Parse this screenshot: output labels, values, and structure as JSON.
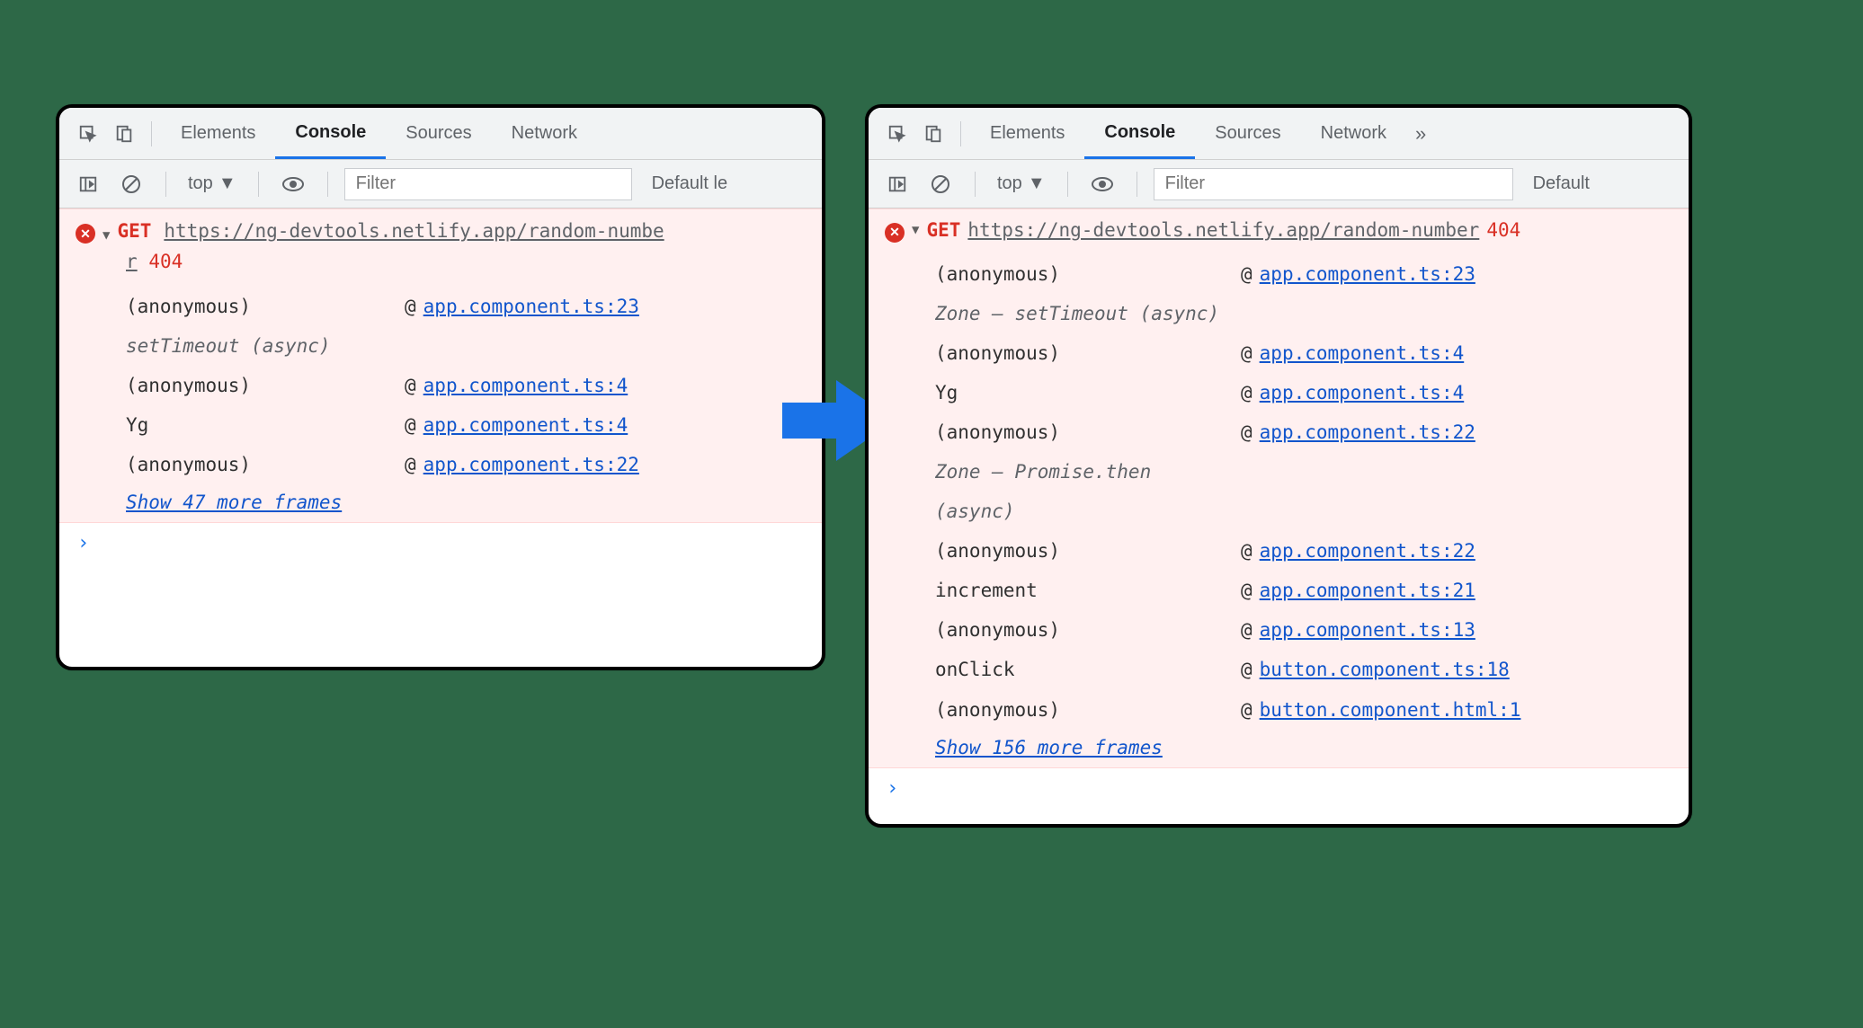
{
  "tabs": {
    "elements": "Elements",
    "console": "Console",
    "sources": "Sources",
    "network": "Network",
    "more": "»"
  },
  "toolbar": {
    "context": "top",
    "filter_placeholder": "Filter",
    "levels_left": "Default le",
    "levels_right": "Default"
  },
  "error": {
    "method": "GET",
    "url": "https://ng-devtools.netlify.app/random-number",
    "url_wrapped_tail": "r",
    "status": "404"
  },
  "left_stack": [
    {
      "fn": "(anonymous)",
      "src": "app.component.ts:23"
    },
    {
      "fn": "setTimeout (async)",
      "async": true
    },
    {
      "fn": "(anonymous)",
      "src": "app.component.ts:4"
    },
    {
      "fn": "Yg",
      "src": "app.component.ts:4"
    },
    {
      "fn": "(anonymous)",
      "src": "app.component.ts:22"
    }
  ],
  "left_showmore": "Show 47 more frames",
  "right_stack": [
    {
      "fn": "(anonymous)",
      "src": "app.component.ts:23"
    },
    {
      "fn": "Zone – setTimeout (async)",
      "async": true
    },
    {
      "fn": "(anonymous)",
      "src": "app.component.ts:4"
    },
    {
      "fn": "Yg",
      "src": "app.component.ts:4"
    },
    {
      "fn": "(anonymous)",
      "src": "app.component.ts:22"
    },
    {
      "fn": "Zone – Promise.then (async)",
      "async": true
    },
    {
      "fn": "(anonymous)",
      "src": "app.component.ts:22"
    },
    {
      "fn": "increment",
      "src": "app.component.ts:21"
    },
    {
      "fn": "(anonymous)",
      "src": "app.component.ts:13"
    },
    {
      "fn": "onClick",
      "src": "button.component.ts:18"
    },
    {
      "fn": "(anonymous)",
      "src": "button.component.html:1"
    }
  ],
  "right_showmore": "Show 156 more frames",
  "prompt": "›"
}
